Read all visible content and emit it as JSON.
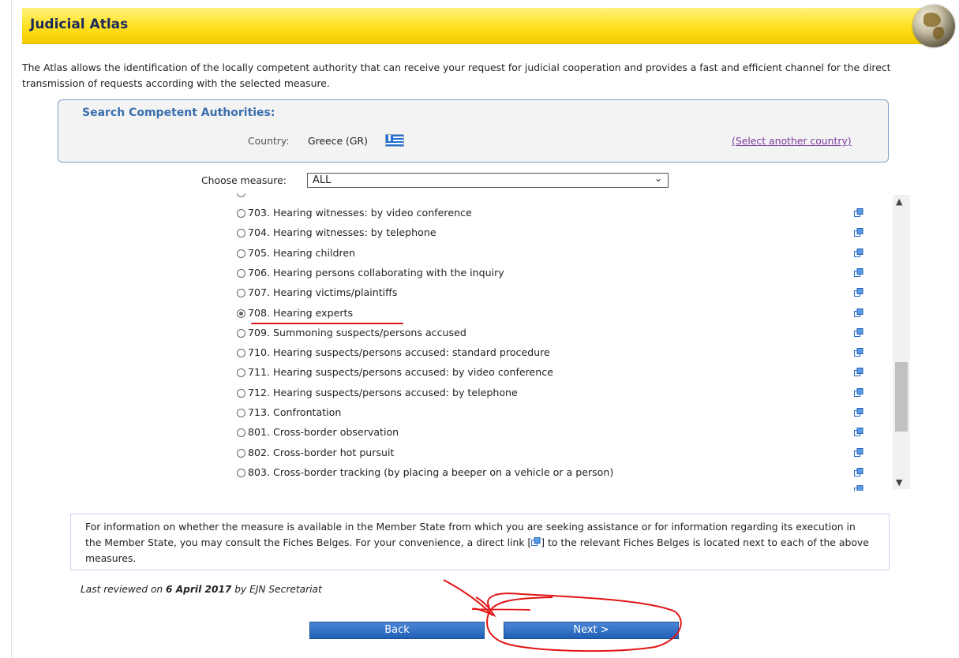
{
  "header": {
    "title": "Judicial Atlas"
  },
  "intro": {
    "text": "The Atlas allows the identification of the locally competent authority that can receive your request for judicial cooperation and provides a fast and efficient channel for the direct transmission of requests according with the selected measure."
  },
  "search": {
    "heading": "Search Competent Authorities:",
    "country_label": "Country:",
    "country_value": "Greece (GR)",
    "select_another": "(Select another country)"
  },
  "measure": {
    "label": "Choose measure:",
    "selected": "ALL",
    "items": [
      {
        "label": "703. Hearing witnesses: by video conference",
        "checked": false
      },
      {
        "label": "704. Hearing witnesses: by telephone",
        "checked": false
      },
      {
        "label": "705. Hearing children",
        "checked": false
      },
      {
        "label": "706. Hearing persons collaborating with the inquiry",
        "checked": false
      },
      {
        "label": "707. Hearing victims/plaintiffs",
        "checked": false
      },
      {
        "label": "708. Hearing experts",
        "checked": true
      },
      {
        "label": "709. Summoning suspects/persons accused",
        "checked": false
      },
      {
        "label": "710. Hearing suspects/persons accused: standard procedure",
        "checked": false
      },
      {
        "label": "711. Hearing suspects/persons accused: by video conference",
        "checked": false
      },
      {
        "label": "712. Hearing suspects/persons accused: by telephone",
        "checked": false
      },
      {
        "label": "713. Confrontation",
        "checked": false
      },
      {
        "label": "801. Cross-border observation",
        "checked": false
      },
      {
        "label": "802. Cross-border hot pursuit",
        "checked": false
      },
      {
        "label": "803. Cross-border tracking (by placing a beeper on a vehicle or a person)",
        "checked": false
      }
    ]
  },
  "info": {
    "part1": "For information on whether the measure is available in the Member State from which you are seeking assistance or for information regarding its execution in the Member State, you may consult the Fiches Belges. For your convenience, a direct link [",
    "part2": "] to the relevant Fiches Belges is located next to each of the above measures."
  },
  "reviewed": {
    "prefix": "Last reviewed on ",
    "date": "6 April 2017",
    "suffix": " by EJN Secretariat"
  },
  "buttons": {
    "back": "Back",
    "next": "Next >"
  },
  "icons": {
    "external": "external-link-icon",
    "globe": "globe-icon",
    "flag": "greece-flag-icon"
  },
  "colors": {
    "header_yellow": "#ffe01e",
    "link_blue": "#3a6fae",
    "button_blue": "#1f5fb6",
    "annotation_red": "#e31515"
  }
}
